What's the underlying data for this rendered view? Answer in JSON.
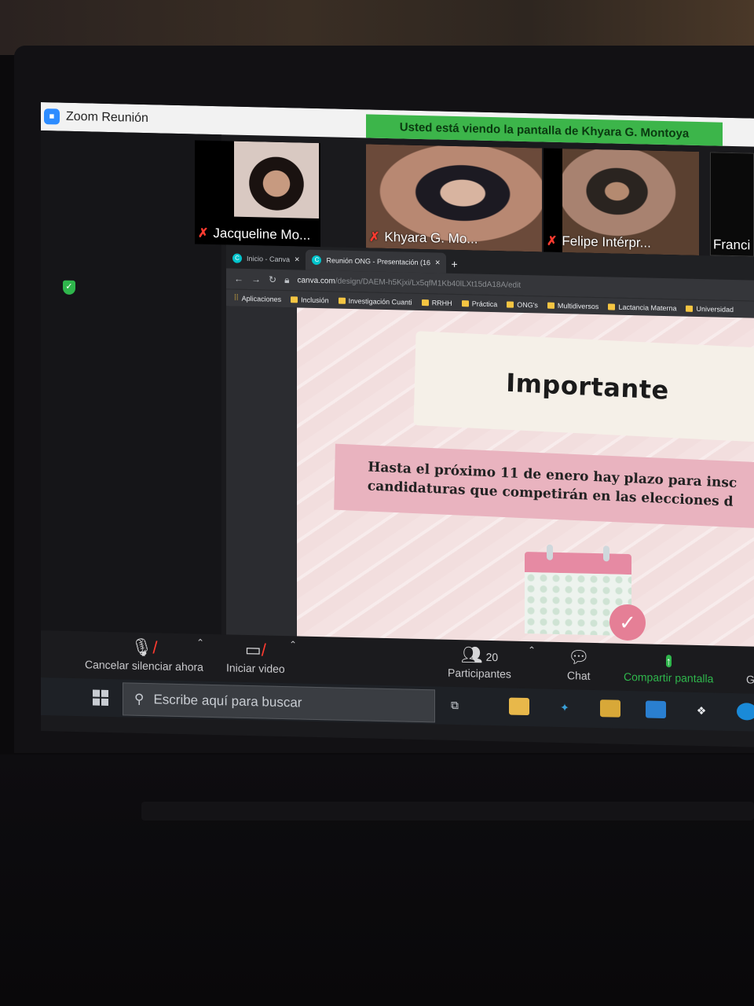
{
  "zoom": {
    "window_title": "Zoom Reunión",
    "share_banner": "Usted está viendo la pantalla de Khyara G. Montoya",
    "participants": [
      {
        "name": "Jacqueline Mo..."
      },
      {
        "name": "Khyara G. Mo..."
      },
      {
        "name": "Felipe Intérpr..."
      },
      {
        "name": "Franci"
      }
    ],
    "toolbar": {
      "unmute_label": "Cancelar silenciar ahora",
      "video_label": "Iniciar video",
      "participants_label": "Participantes",
      "participants_count": "20",
      "chat_label": "Chat",
      "share_label": "Compartir pantalla",
      "more_label": "G"
    }
  },
  "browser": {
    "tabs": [
      {
        "title": "Inicio - Canva"
      },
      {
        "title": "Reunión ONG - Presentación (16"
      }
    ],
    "url_host": "canva.com",
    "url_path": "/design/DAEM-h5Kjxi/Lx5qfM1Kb40lLXt15dA18A/edit",
    "bookmarks": [
      "Aplicaciones",
      "Inclusión",
      "Investigación Cuanti",
      "RRHH",
      "Práctica",
      "ONG's",
      "Multidiversos",
      "Lactancia Materna",
      "Universidad"
    ]
  },
  "slide": {
    "title": "Importante",
    "body": "Hasta el próximo 11 de enero hay plazo para insc\ncandidaturas que competirán en las elecciones d"
  },
  "taskbar": {
    "search_placeholder": "Escribe aquí para buscar"
  },
  "icons": [
    "zoom-logo-icon",
    "shield-icon",
    "mic-off-icon",
    "video-off-icon",
    "participants-icon",
    "chat-icon",
    "share-screen-icon",
    "windows-start-icon",
    "search-icon",
    "task-view-icon",
    "file-explorer-icon",
    "store-icon",
    "mail-icon",
    "dropbox-icon"
  ],
  "colors": {
    "zoom_green": "#3cb54a",
    "mute_red": "#ff3b30",
    "slide_pink": "#e9b3bf"
  }
}
